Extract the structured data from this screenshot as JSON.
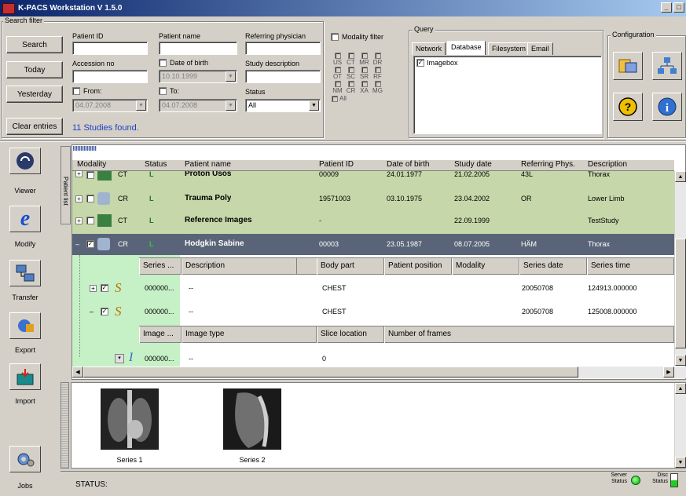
{
  "window": {
    "title": "K-PACS Workstation V 1.5.0"
  },
  "search_filter": {
    "group_label": "Search filter",
    "search_label": "Search",
    "today_label": "Today",
    "yesterday_label": "Yesterday",
    "clear_label": "Clear entries",
    "patient_id_label": "Patient ID",
    "patient_id_value": "",
    "patient_name_label": "Patient name",
    "patient_name_value": "",
    "referring_label": "Referring physician",
    "referring_value": "",
    "accession_label": "Accession no",
    "accession_value": "",
    "dob_label": "Date of birth",
    "dob_value": "10.10.1999",
    "study_desc_label": "Study description",
    "study_desc_value": "",
    "from_label": "From:",
    "from_value": "04.07.2008",
    "to_label": "To:",
    "to_value": "04.07.2008",
    "status_label": "Status",
    "status_value": "All",
    "result_text": "11 Studies found."
  },
  "modality_filter": {
    "label": "Modality filter",
    "rows": [
      [
        "US",
        "CT",
        "MR",
        "DR"
      ],
      [
        "OT",
        "SC",
        "SR",
        "RF"
      ],
      [
        "NM",
        "CR",
        "XA",
        "MG"
      ]
    ],
    "all_label": "All"
  },
  "query": {
    "group_label": "Query",
    "tabs": [
      "Network",
      "Database",
      "Filesystem",
      "Email"
    ],
    "active_tab": "Database",
    "items": [
      {
        "label": "Imagebox",
        "checked": true
      }
    ]
  },
  "configuration": {
    "group_label": "Configuration"
  },
  "sidebar": {
    "items": [
      {
        "label": "Viewer"
      },
      {
        "label": "Modify"
      },
      {
        "label": "Transfer"
      },
      {
        "label": "Export"
      },
      {
        "label": "Import"
      },
      {
        "label": "Jobs"
      }
    ],
    "vertical_tab": "Patient list"
  },
  "study_table": {
    "columns": [
      "Modality",
      "Status",
      "Patient name",
      "Patient ID",
      "Date of birth",
      "Study date",
      "Referring Phys.",
      "Description"
    ],
    "rows": [
      {
        "modality": "CT",
        "status": "L",
        "name": "Proton  Usos",
        "id": "00009",
        "dob": "24.01.1977",
        "study_date": "21.02.2005",
        "ref": "43L",
        "desc": "Thorax"
      },
      {
        "modality": "CR",
        "status": "L",
        "name": "Trauma  Poly",
        "id": "19571003",
        "dob": "03.10.1975",
        "study_date": "23.04.2002",
        "ref": "OR",
        "desc": "Lower Limb"
      },
      {
        "modality": "CT",
        "status": "L",
        "name": "Reference Images",
        "id": "-",
        "dob": "",
        "study_date": "22.09.1999",
        "ref": "",
        "desc": "TestStudy"
      },
      {
        "modality": "CR",
        "status": "L",
        "name": "Hodgkin  Sabine",
        "id": "00003",
        "dob": "23.05.1987",
        "study_date": "08.07.2005",
        "ref": "HÄM",
        "desc": "Thorax"
      }
    ],
    "series_columns": [
      "Series ...",
      "Description",
      "Body part",
      "Patient position",
      "Modality",
      "Series date",
      "Series time"
    ],
    "series_rows": [
      {
        "num": "000000...",
        "desc": "--",
        "body": "CHEST",
        "pos": "",
        "mod": "",
        "date": "20050708",
        "time": "124913.000000"
      },
      {
        "num": "000000...",
        "desc": "--",
        "body": "CHEST",
        "pos": "",
        "mod": "",
        "date": "20050708",
        "time": "125008.000000"
      }
    ],
    "image_columns": [
      "Image ...",
      "Image type",
      "Slice location",
      "Number of frames"
    ],
    "image_rows": [
      {
        "num": "000000...",
        "type": "--",
        "slice": "0",
        "frames": ""
      }
    ]
  },
  "thumbnails": [
    {
      "label": "Series 1"
    },
    {
      "label": "Series 2"
    }
  ],
  "statusbar": {
    "status_label": "STATUS:",
    "server_status": "Server Status",
    "disc_status": "Disc Status"
  }
}
